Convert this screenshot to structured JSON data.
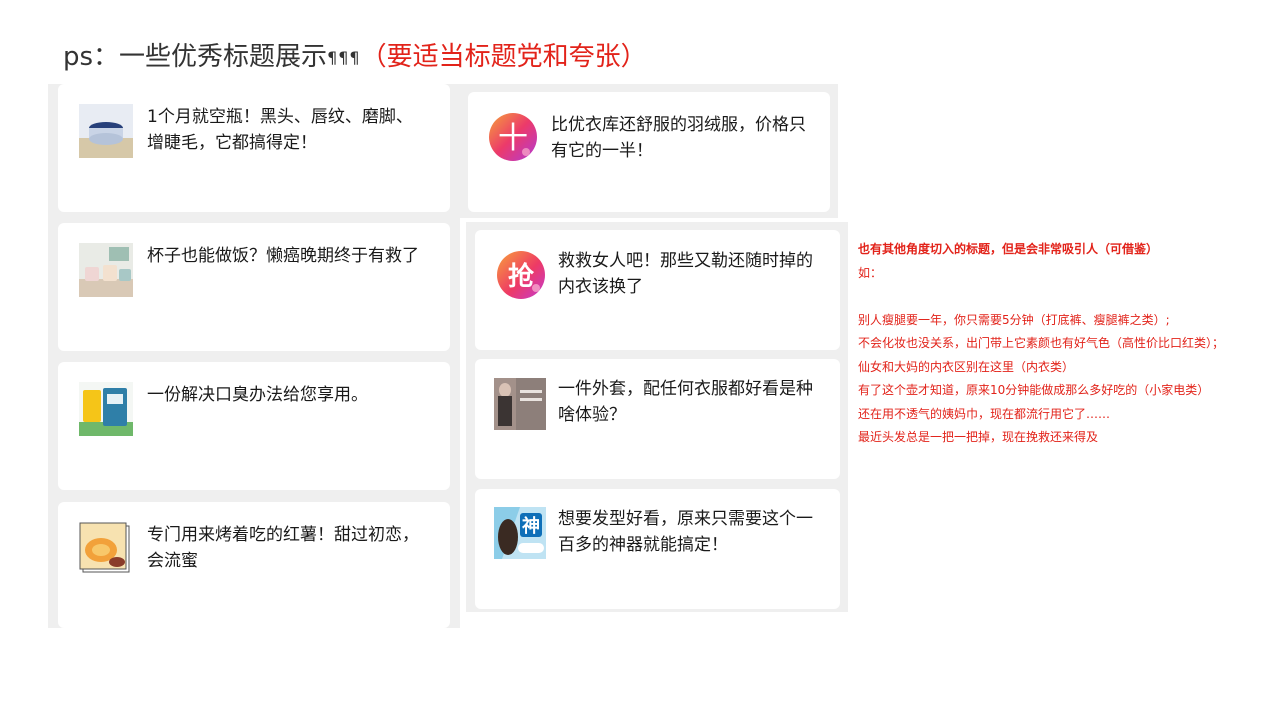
{
  "title": {
    "main": "ps：一些优秀标题展示",
    "marks": "¶¶¶",
    "highlight": "（要适当标题党和夸张）"
  },
  "left_cards": [
    {
      "text": "1个月就空瓶！黑头、唇纹、磨脚、增睫毛，它都搞得定！",
      "thumb": "lip-balm-product-thumbnail"
    },
    {
      "text": "杯子也能做饭？懒癌晚期终于有救了",
      "thumb": "cup-cooking-thumbnail"
    },
    {
      "text": "一份解决口臭办法给您享用。",
      "thumb": "breath-spray-product-thumbnail"
    },
    {
      "text": "专门用来烤着吃的红薯！甜过初恋，会流蜜",
      "thumb": "sweet-potato-thumbnail"
    }
  ],
  "right_cards": [
    {
      "text": "比优衣库还舒服的羽绒服，价格只有它的一半！",
      "thumb": "ten-badge-icon",
      "glyph": "十"
    },
    {
      "text": "救救女人吧！那些又勒还随时掉的内衣该换了",
      "thumb": "grab-badge-icon",
      "glyph": "抢"
    },
    {
      "text": "一件外套，配任何衣服都好看是种啥体验？",
      "thumb": "coat-fashion-thumbnail"
    },
    {
      "text": "想要发型好看，原来只需要这个一百多的神器就能搞定！",
      "thumb": "hair-tool-thumbnail",
      "glyph": "神"
    }
  ],
  "notes": {
    "heading": "也有其他角度切入的标题，但是会非常吸引人（可借鉴）",
    "intro": "如：",
    "lines": [
      "别人瘦腿要一年，你只需要5分钟（打底裤、瘦腿裤之类）;",
      "不会化妆也没关系，出门带上它素颜也有好气色（高性价比口红类）；",
      "仙女和大妈的内衣区别在这里（内衣类）",
      "有了这个壶才知道，原来10分钟能做成那么多好吃的（小家电类）",
      "还在用不透气的姨妈巾，现在都流行用它了……",
      "最近头发总是一把一把掉，现在挽救还来得及"
    ]
  },
  "colors": {
    "accent_red": "#e2231a",
    "panel_gray": "#efefef",
    "card_white": "#ffffff"
  }
}
